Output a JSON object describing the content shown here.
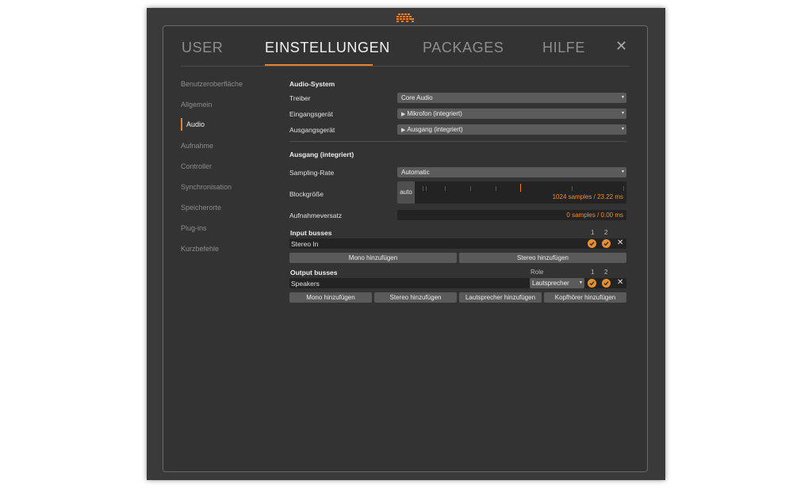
{
  "tabs": {
    "user": "USER",
    "settings": "EINSTELLUNGEN",
    "packages": "PACKAGES",
    "help": "HILFE",
    "close": "✕"
  },
  "sidebar": {
    "items": [
      {
        "label": "Benutzeroberfläche"
      },
      {
        "label": "Allgemein"
      },
      {
        "label": "Audio"
      },
      {
        "label": "Aufnahme"
      },
      {
        "label": "Controller"
      },
      {
        "label": "Synchronisation"
      },
      {
        "label": "Speicherorte"
      },
      {
        "label": "Plug-ins"
      },
      {
        "label": "Kurzbefehle"
      }
    ],
    "active": "Audio"
  },
  "audio_system": {
    "heading": "Audio-System",
    "driver_label": "Treiber",
    "driver_value": "Core Audio",
    "input_label": "Eingangsgerät",
    "input_value": "Mikrofon (integriert)",
    "output_label": "Ausgangsgerät",
    "output_value": "Ausgang (integriert)"
  },
  "output_device": {
    "heading": "Ausgang (integriert)",
    "rate_label": "Sampling-Rate",
    "rate_value": "Automatic",
    "block_label": "Blockgröße",
    "block_auto": "auto",
    "block_value": "1024 samples / 23.22 ms",
    "latency_label": "Aufnahmeversatz",
    "latency_value": "0 samples / 0.00 ms"
  },
  "input_busses": {
    "heading": "Input busses",
    "col1": "1",
    "col2": "2",
    "bus_name": "Stereo In",
    "remove": "✕",
    "add_mono": "Mono hinzufügen",
    "add_stereo": "Stereo hinzufügen"
  },
  "output_busses": {
    "heading": "Output busses",
    "role_header": "Role",
    "col1": "1",
    "col2": "2",
    "bus_name": "Speakers",
    "role_value": "Lautsprecher",
    "remove": "✕",
    "add_mono": "Mono hinzufügen",
    "add_stereo": "Stereo hinzufügen",
    "add_speakers": "Lautsprecher hinzufügen",
    "add_headphones": "Kopfhörer hinzufügen"
  },
  "colors": {
    "accent": "#e8802e",
    "window_bg": "#3a3a3a",
    "panel_bg": "#333333",
    "field_bg": "#5b5b5b",
    "dark_field": "#232323"
  },
  "icons": {
    "logo": "bitwig-logo-icon",
    "dropdown": "dropdown-arrow-icon",
    "play": "play-triangle-icon",
    "check": "check-circle-icon",
    "close": "close-icon"
  }
}
